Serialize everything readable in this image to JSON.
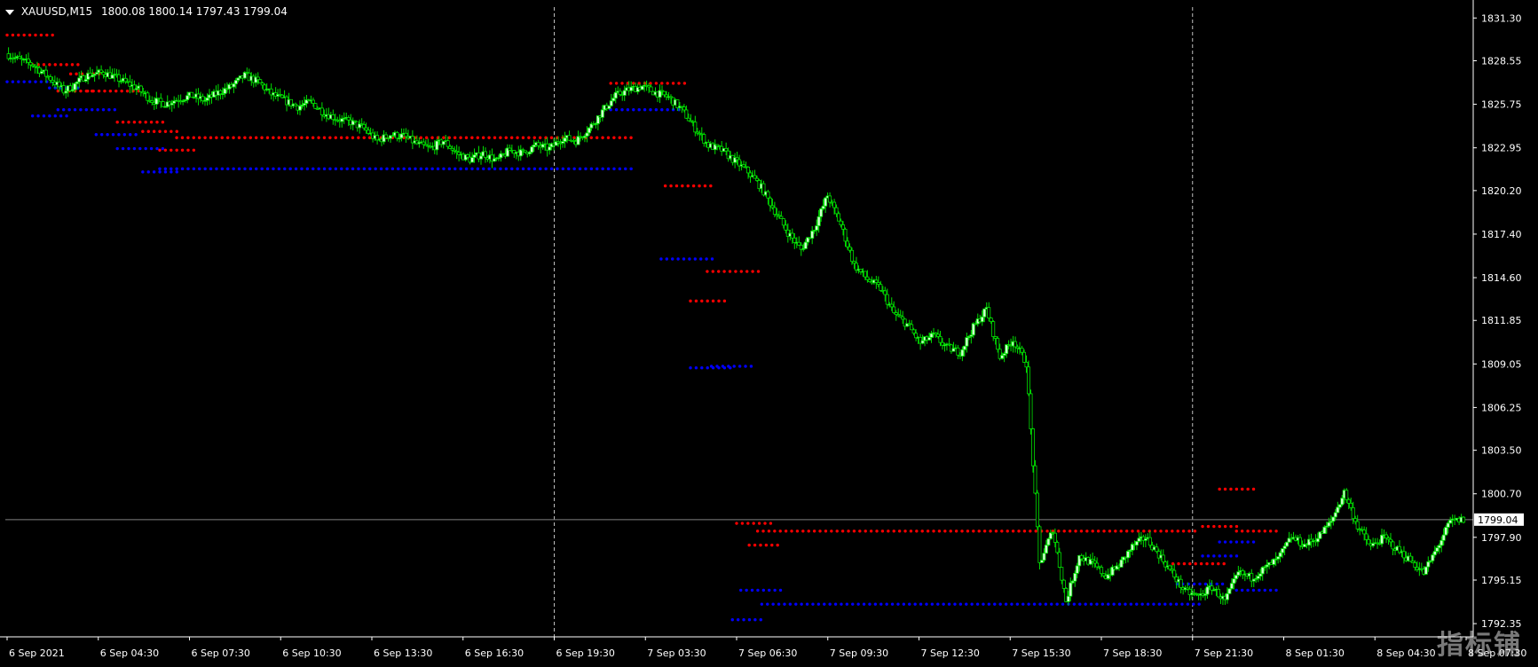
{
  "header": {
    "symbol": "XAUUSD,M15",
    "ohlc": "1800.08 1800.14 1797.43 1799.04"
  },
  "colors": {
    "background": "#000000",
    "axis": "#ffffff",
    "bull_fill": "#ccffcc",
    "wick": "#00e000",
    "resistance_dots": "#ff0000",
    "support_dots": "#0000ff",
    "price_line": "#808080",
    "separator": "#c0c0c0"
  },
  "current_price_label": "1799.04",
  "watermark": "指标铺",
  "chart_data": {
    "type": "candlestick",
    "title": "",
    "ylim": [
      1791.5,
      1832.0
    ],
    "y_ticks": [
      "1831.30",
      "1828.55",
      "1825.75",
      "1822.95",
      "1820.20",
      "1817.40",
      "1814.60",
      "1811.85",
      "1809.05",
      "1806.25",
      "1803.50",
      "1800.70",
      "1797.90",
      "1795.15",
      "1792.35"
    ],
    "x_labels": [
      "6 Sep 2021",
      "6 Sep 04:30",
      "6 Sep 07:30",
      "6 Sep 10:30",
      "6 Sep 13:30",
      "6 Sep 16:30",
      "6 Sep 19:30",
      "7 Sep 03:30",
      "7 Sep 06:30",
      "7 Sep 09:30",
      "7 Sep 12:30",
      "7 Sep 15:30",
      "7 Sep 18:30",
      "7 Sep 21:30",
      "8 Sep 01:30",
      "8 Sep 04:30",
      "8 Sep 07:30"
    ],
    "day_separators": [
      "6 Sep 19:30",
      "7 Sep 21:30"
    ],
    "current_price": 1799.04,
    "price_path": [
      [
        0,
        1829.0
      ],
      [
        6,
        1828.6
      ],
      [
        12,
        1828.3
      ],
      [
        20,
        1827.4
      ],
      [
        26,
        1826.6
      ],
      [
        30,
        1826.9
      ],
      [
        36,
        1827.6
      ],
      [
        44,
        1827.8
      ],
      [
        52,
        1827.3
      ],
      [
        60,
        1826.7
      ],
      [
        66,
        1826.0
      ],
      [
        72,
        1825.8
      ],
      [
        78,
        1826.1
      ],
      [
        84,
        1826.3
      ],
      [
        90,
        1826.0
      ],
      [
        96,
        1826.5
      ],
      [
        102,
        1826.9
      ],
      [
        108,
        1827.6
      ],
      [
        114,
        1827.2
      ],
      [
        120,
        1826.4
      ],
      [
        126,
        1826.0
      ],
      [
        132,
        1825.6
      ],
      [
        138,
        1825.9
      ],
      [
        144,
        1825.2
      ],
      [
        150,
        1824.8
      ],
      [
        156,
        1824.6
      ],
      [
        162,
        1824.2
      ],
      [
        168,
        1823.4
      ],
      [
        174,
        1823.8
      ],
      [
        180,
        1823.7
      ],
      [
        186,
        1823.2
      ],
      [
        192,
        1822.9
      ],
      [
        198,
        1823.4
      ],
      [
        204,
        1822.6
      ],
      [
        210,
        1822.2
      ],
      [
        216,
        1822.6
      ],
      [
        222,
        1822.1
      ],
      [
        228,
        1822.8
      ],
      [
        234,
        1822.6
      ],
      [
        240,
        1823.1
      ],
      [
        246,
        1822.9
      ],
      [
        252,
        1823.6
      ],
      [
        258,
        1823.4
      ],
      [
        264,
        1824.2
      ],
      [
        270,
        1825.3
      ],
      [
        276,
        1826.3
      ],
      [
        282,
        1826.7
      ],
      [
        288,
        1826.9
      ],
      [
        294,
        1826.5
      ],
      [
        300,
        1826.2
      ],
      [
        306,
        1825.4
      ],
      [
        312,
        1824.2
      ],
      [
        318,
        1823.1
      ],
      [
        324,
        1822.8
      ],
      [
        330,
        1822.1
      ],
      [
        336,
        1821.4
      ],
      [
        342,
        1820.4
      ],
      [
        348,
        1818.9
      ],
      [
        354,
        1817.5
      ],
      [
        360,
        1816.4
      ],
      [
        366,
        1817.8
      ],
      [
        372,
        1819.9
      ],
      [
        378,
        1818.0
      ],
      [
        384,
        1815.4
      ],
      [
        390,
        1814.5
      ],
      [
        396,
        1813.9
      ],
      [
        402,
        1812.3
      ],
      [
        408,
        1811.6
      ],
      [
        414,
        1810.4
      ],
      [
        420,
        1810.9
      ],
      [
        426,
        1810.1
      ],
      [
        432,
        1809.8
      ],
      [
        438,
        1811.4
      ],
      [
        444,
        1812.6
      ],
      [
        450,
        1809.5
      ],
      [
        456,
        1810.6
      ],
      [
        462,
        1809.1
      ],
      [
        468,
        1796.2
      ],
      [
        474,
        1798.4
      ],
      [
        480,
        1793.8
      ],
      [
        486,
        1796.7
      ],
      [
        492,
        1796.2
      ],
      [
        498,
        1795.4
      ],
      [
        504,
        1796.1
      ],
      [
        510,
        1797.3
      ],
      [
        516,
        1797.9
      ],
      [
        522,
        1796.8
      ],
      [
        528,
        1795.6
      ],
      [
        534,
        1794.4
      ],
      [
        540,
        1794.1
      ],
      [
        546,
        1794.7
      ],
      [
        552,
        1793.8
      ],
      [
        558,
        1795.6
      ],
      [
        564,
        1795.3
      ],
      [
        570,
        1795.9
      ],
      [
        576,
        1796.5
      ],
      [
        582,
        1797.9
      ],
      [
        588,
        1797.4
      ],
      [
        594,
        1797.9
      ],
      [
        600,
        1798.9
      ],
      [
        606,
        1800.8
      ],
      [
        612,
        1798.6
      ],
      [
        618,
        1797.3
      ],
      [
        624,
        1797.9
      ],
      [
        630,
        1797.1
      ],
      [
        636,
        1796.4
      ],
      [
        642,
        1795.6
      ],
      [
        648,
        1797.2
      ],
      [
        654,
        1798.9
      ],
      [
        660,
        1799.04
      ]
    ],
    "resistance_segments": [
      {
        "from": "6 Sep 00:00",
        "price": 1830.2
      },
      {
        "from": "6 Sep 03:00",
        "price": 1828.3
      },
      {
        "from": "6 Sep 06:00",
        "price": 1826.6
      },
      {
        "from": "6 Sep 07:30",
        "price": 1827.7
      },
      {
        "from": "6 Sep 09:30",
        "price": 1826.6
      },
      {
        "from": "6 Sep 13:00",
        "price": 1824.6
      },
      {
        "from": "6 Sep 16:00",
        "price": 1824.0
      },
      {
        "from": "6 Sep 18:00",
        "price": 1822.8
      },
      {
        "from": "6 Sep 20:00",
        "price": 1823.6
      },
      {
        "from": "7 Sep 03:00",
        "price": 1827.1
      },
      {
        "from": "7 Sep 09:30",
        "price": 1820.5
      },
      {
        "from": "7 Sep 12:30",
        "price": 1813.1
      },
      {
        "from": "7 Sep 14:30",
        "price": 1815.0
      },
      {
        "from": "7 Sep 18:00",
        "price": 1798.8
      },
      {
        "from": "7 Sep 19:30",
        "price": 1797.4
      },
      {
        "from": "7 Sep 20:30",
        "price": 1798.3
      },
      {
        "from": "8 Sep 00:00",
        "price": 1796.2
      },
      {
        "from": "8 Sep 03:30",
        "price": 1798.6
      },
      {
        "from": "8 Sep 05:30",
        "price": 1801.0
      },
      {
        "from": "8 Sep 07:30",
        "price": 1798.3
      }
    ],
    "support_segments": [
      {
        "from": "6 Sep 00:00",
        "price": 1827.2
      },
      {
        "from": "6 Sep 03:00",
        "price": 1825.0
      },
      {
        "from": "6 Sep 05:00",
        "price": 1826.8
      },
      {
        "from": "6 Sep 06:00",
        "price": 1825.4
      },
      {
        "from": "6 Sep 10:30",
        "price": 1823.8
      },
      {
        "from": "6 Sep 13:00",
        "price": 1822.9
      },
      {
        "from": "6 Sep 16:00",
        "price": 1821.4
      },
      {
        "from": "6 Sep 18:00",
        "price": 1821.6
      },
      {
        "from": "7 Sep 03:00",
        "price": 1825.4
      },
      {
        "from": "7 Sep 09:00",
        "price": 1815.8
      },
      {
        "from": "7 Sep 12:30",
        "price": 1808.8
      },
      {
        "from": "7 Sep 15:00",
        "price": 1808.9
      },
      {
        "from": "7 Sep 17:30",
        "price": 1792.6
      },
      {
        "from": "7 Sep 18:30",
        "price": 1794.5
      },
      {
        "from": "7 Sep 21:00",
        "price": 1793.6
      },
      {
        "from": "8 Sep 00:30",
        "price": 1794.9
      },
      {
        "from": "8 Sep 03:30",
        "price": 1796.7
      },
      {
        "from": "8 Sep 05:30",
        "price": 1797.6
      },
      {
        "from": "8 Sep 07:30",
        "price": 1794.5
      }
    ]
  }
}
